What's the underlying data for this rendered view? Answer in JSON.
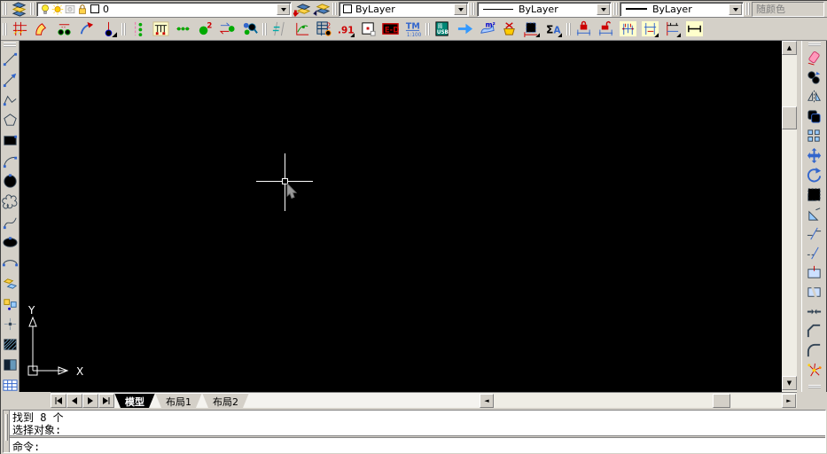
{
  "colors": {
    "window_bg": "#d4d0c8",
    "canvas_bg": "#000000",
    "crosshair": "#ffffff",
    "active_tab_bg": "#000000",
    "active_tab_text": "#ffffff"
  },
  "layer_toolbar": {
    "tool_icons": [
      "layer-properties",
      "make-object-layer-current",
      "layer-previous"
    ],
    "layer_combo": {
      "state_icons": [
        "bulb",
        "sun",
        "vp-freeze",
        "lock"
      ],
      "color_swatch": "#ffffff",
      "value": "0"
    },
    "color_combo": {
      "swatch": "#ffffff",
      "value": "ByLayer"
    },
    "linetype_combo": {
      "value": "ByLayer"
    },
    "lineweight_combo": {
      "value": "ByLayer"
    },
    "plot_style_combo": {
      "value": "随颜色",
      "disabled": true
    }
  },
  "custom_toolbar": {
    "groups": [
      [
        "axis-grid",
        "arc-wall",
        "axis-circles",
        "curved-arrow",
        "axis-number"
      ],
      [
        "axis-dots",
        "beam-table",
        "dot-axis",
        "ball-2",
        "swap-ball",
        "search-balls"
      ],
      [
        "axis-compare",
        "curve-stat",
        "table-calc",
        "decimal-91",
        "box-dot",
        "ed-label",
        "tm-scale"
      ],
      [
        "usb-board",
        "blue-arrow",
        "area-m2",
        "yellow-cart",
        "dim-frame",
        "sigma-a"
      ],
      [
        "dim-lock",
        "dim-unlock",
        "dim-grid-a",
        "dim-grid-b",
        "dim-red",
        "dim-plain"
      ]
    ]
  },
  "draw_toolbar": {
    "icons": [
      "line",
      "construction-line",
      "polyline",
      "polygon",
      "rectangle",
      "arc",
      "circle",
      "revision-cloud",
      "spline",
      "ellipse",
      "ellipse-arc",
      "insert-block",
      "make-block",
      "point",
      "hatch",
      "gradient",
      "table"
    ]
  },
  "modify_toolbar": {
    "icons": [
      "erase",
      "copy",
      "mirror",
      "offset",
      "array",
      "move",
      "rotate",
      "scale",
      "stretch",
      "trim",
      "extend",
      "break-at-point",
      "break",
      "join",
      "chamfer",
      "fillet",
      "explode"
    ],
    "extra_icons": [
      "dock-panel"
    ]
  },
  "canvas": {
    "ucs": {
      "x_label": "X",
      "y_label": "Y"
    }
  },
  "model_tabs": {
    "nav_icons": [
      "first-tab",
      "previous-tab",
      "next-tab",
      "last-tab"
    ],
    "tabs": [
      {
        "label": "模型",
        "active": true
      },
      {
        "label": "布局1",
        "active": false
      },
      {
        "label": "布局2",
        "active": false
      }
    ]
  },
  "command_window": {
    "history": [
      "找到 8 个",
      "选择对象:"
    ],
    "prompt": "命令:"
  }
}
